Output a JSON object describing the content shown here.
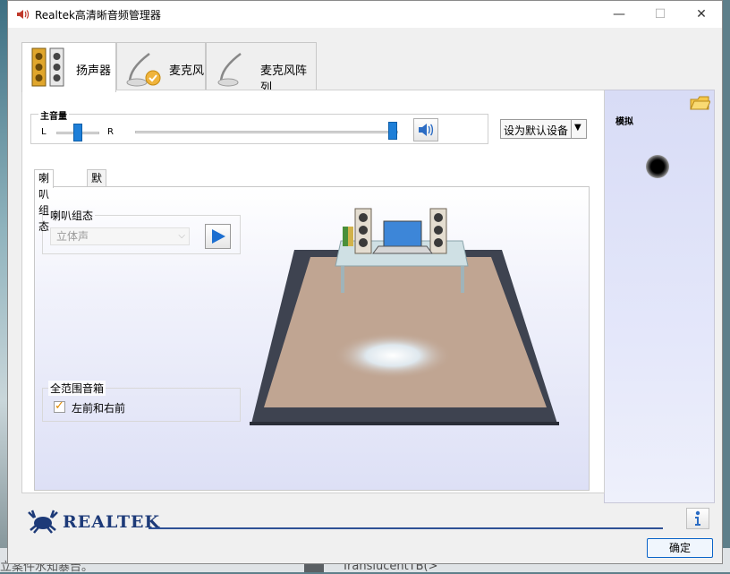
{
  "window": {
    "title": "Realtek高清晰音频管理器"
  },
  "device_tabs": [
    {
      "label": "扬声器",
      "icon": "speaker-icon"
    },
    {
      "label": "麦克风",
      "icon": "microphone-icon"
    },
    {
      "label": "麦克风阵列",
      "icon": "microphone-array-icon"
    }
  ],
  "main_volume": {
    "label": "主音量",
    "left_label": "L",
    "right_label": "R",
    "balance": 0.5,
    "volume": 0.98
  },
  "set_default_button": {
    "label": "设为默认设备"
  },
  "sub_tabs": [
    {
      "label": "喇叭组态"
    },
    {
      "label": "默认格式"
    }
  ],
  "speaker_config": {
    "group_label": "喇叭组态",
    "selected": "立体声"
  },
  "full_range": {
    "group_label": "全范围音箱",
    "checkbox_label": "左前和右前",
    "checked": true
  },
  "side_panel": {
    "label": "模拟"
  },
  "footer": {
    "brand": "REALTEK",
    "ok_label": "确定"
  },
  "background": {
    "partial_text": "TranslucentTB(>",
    "partial_text_left": "立案件水知暴台。"
  },
  "colors": {
    "accent": "#1e7fd8",
    "brand": "#1d3a78"
  }
}
